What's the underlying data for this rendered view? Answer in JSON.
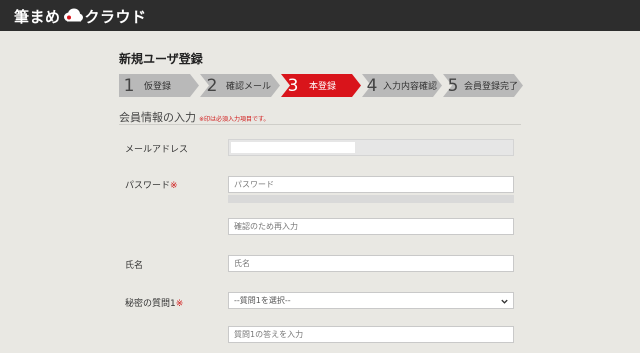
{
  "header": {
    "logo_left": "筆まめ",
    "logo_right": "クラウド",
    "logo_icon": "cloud-icon"
  },
  "page": {
    "title": "新規ユーザ登録"
  },
  "steps": [
    {
      "num": "1",
      "label": "仮登録",
      "active": false
    },
    {
      "num": "2",
      "label": "確認メール",
      "active": false
    },
    {
      "num": "3",
      "label": "本登録",
      "active": true
    },
    {
      "num": "4",
      "label": "入力内容確認",
      "active": false
    },
    {
      "num": "5",
      "label": "会員登録完了",
      "active": false
    }
  ],
  "colors": {
    "active_step": "#d9141b",
    "inactive_step": "#b9b9b9",
    "header": "#2d2d2d",
    "required": "#d11a1a"
  },
  "section": {
    "title": "会員情報の入力",
    "note": "※印は必須入力項目です。"
  },
  "form": {
    "email_label": "メールアドレス",
    "password_label": "パスワード",
    "required_mark": "※",
    "password_placeholder": "パスワード",
    "password_confirm_placeholder": "確認のため再入力",
    "name_label": "氏名",
    "name_placeholder": "氏名",
    "secret_q1_label": "秘密の質問1",
    "secret_q1_selected": "--質問1を選択--",
    "secret_a1_placeholder": "質問1の答えを入力"
  }
}
